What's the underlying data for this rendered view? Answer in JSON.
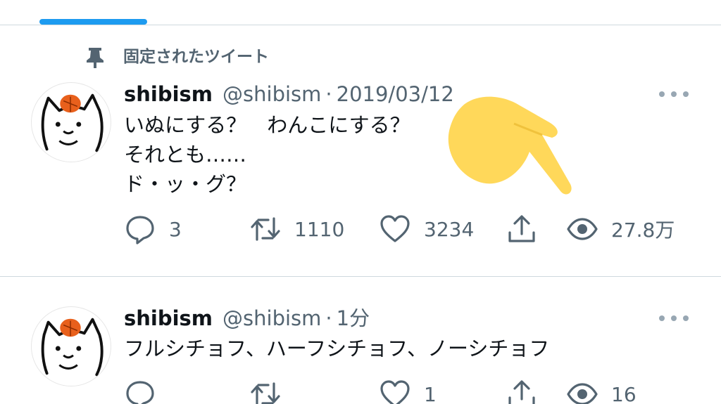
{
  "pinned": {
    "label": "固定されたツイート"
  },
  "tweets": [
    {
      "name": "shibism",
      "handle": "@shibism",
      "separator": "·",
      "time": "2019/03/12",
      "lines": [
        "いぬにする？　わんこにする？",
        "それとも……",
        "ド・ッ・グ？"
      ],
      "replies": "3",
      "retweets": "1110",
      "likes": "3234",
      "views": "27.8万"
    },
    {
      "name": "shibism",
      "handle": "@shibism",
      "separator": "·",
      "time": "1分",
      "lines": [
        "フルシチョフ、ハーフシチョフ、ノーシチョフ"
      ],
      "replies": "",
      "retweets": "",
      "likes": "1",
      "views": "16"
    }
  ],
  "colors": {
    "accent": "#1d9bf0",
    "secondary_text": "#536471",
    "hand": "#ffd85a"
  },
  "icons": [
    "pin-icon",
    "reply-icon",
    "retweet-icon",
    "like-icon",
    "share-icon",
    "views-icon",
    "more-icon",
    "pointing-hand-emoji"
  ]
}
